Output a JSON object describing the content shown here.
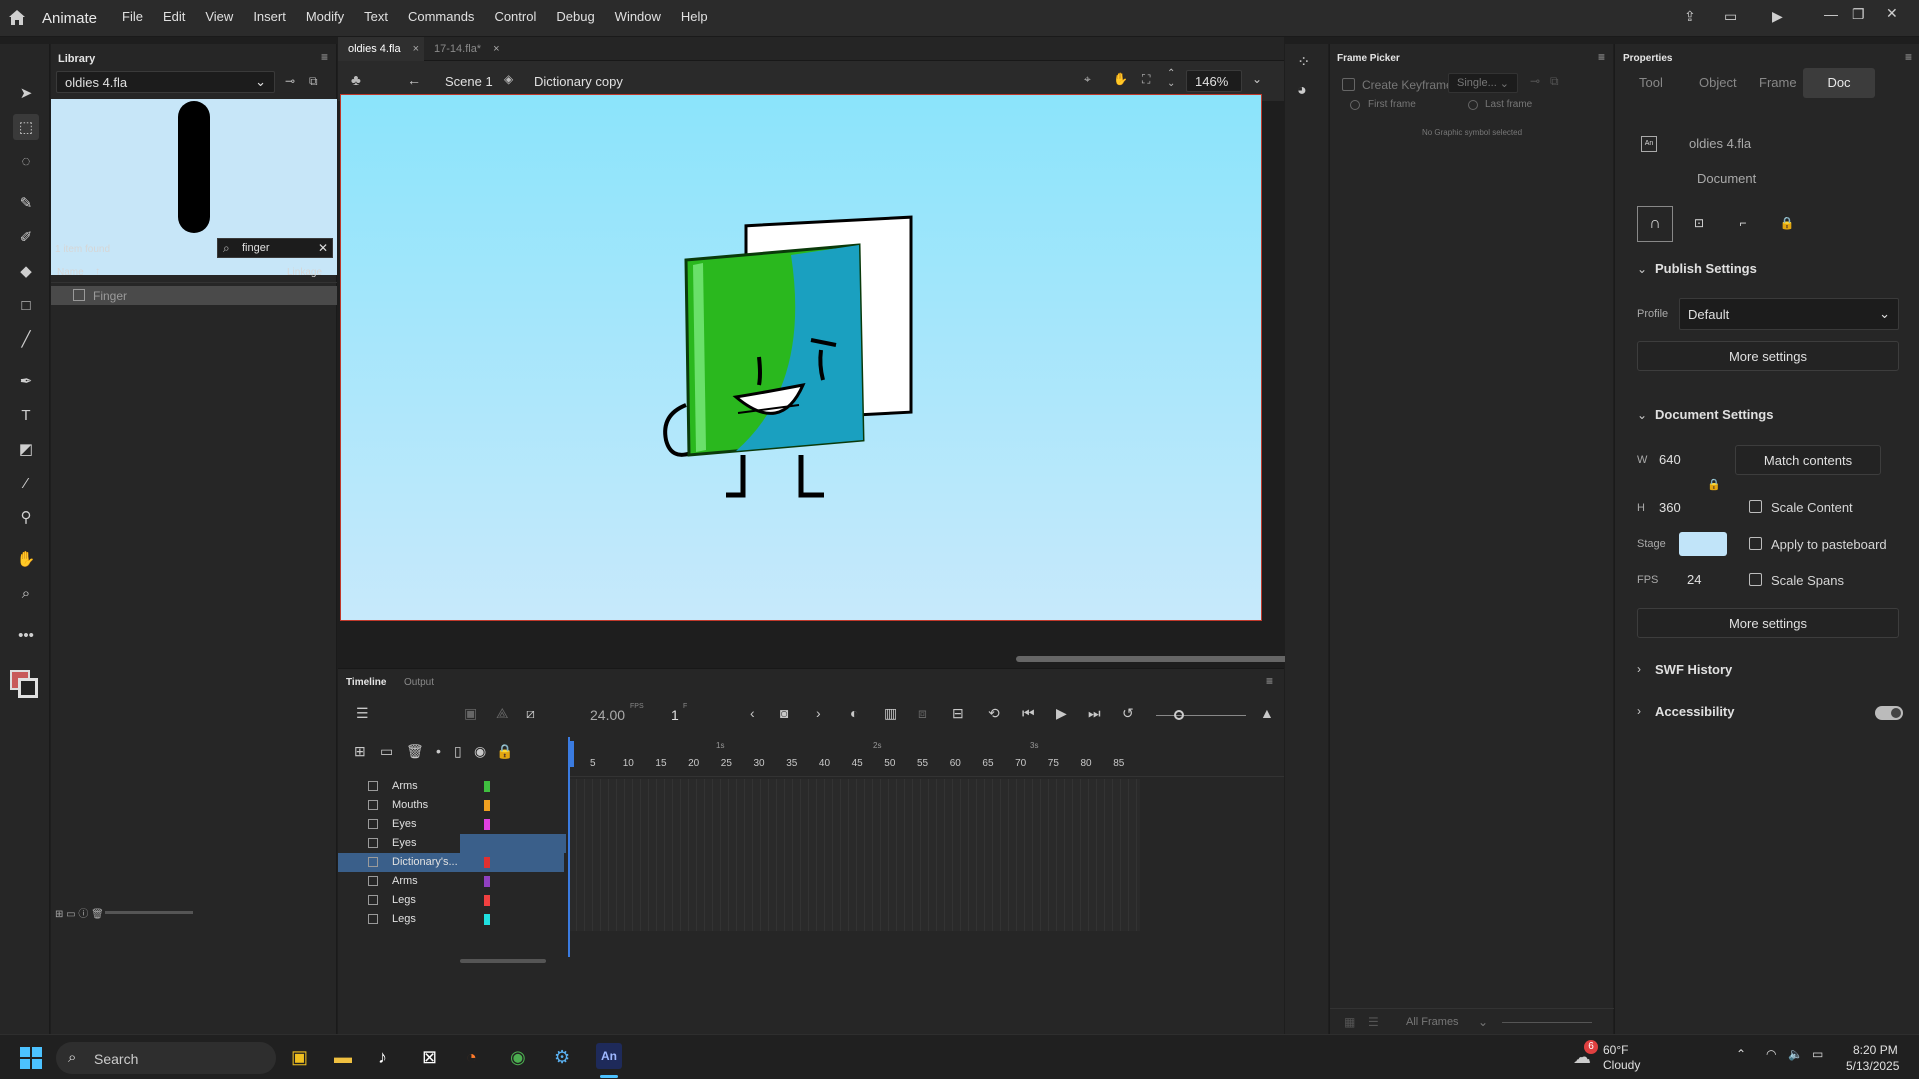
{
  "app": {
    "name": "Animate",
    "menus": [
      "File",
      "Edit",
      "View",
      "Insert",
      "Modify",
      "Text",
      "Commands",
      "Control",
      "Debug",
      "Window",
      "Help"
    ]
  },
  "library": {
    "title": "Library",
    "file": "oldies 4.fla",
    "found": "1 item found",
    "search": "finger",
    "col_name": "Name",
    "col_link": "Linkage",
    "item": "Finger"
  },
  "tabs": [
    {
      "label": "oldies 4.fla"
    },
    {
      "label": "17-14.fla*"
    }
  ],
  "editbar": {
    "scene": "Scene 1",
    "symbol": "Dictionary copy",
    "zoom": "146%"
  },
  "timeline": {
    "tab1": "Timeline",
    "tab2": "Output",
    "fps": "24.00",
    "fps_unit": "FPS",
    "frame": "1",
    "frame_unit": "F",
    "ruler": [
      "5",
      "10",
      "15",
      "20",
      "25",
      "30",
      "35",
      "40",
      "45",
      "50",
      "55",
      "60",
      "65",
      "70",
      "75",
      "80",
      "85"
    ],
    "seconds": [
      "1s",
      "2s",
      "3s"
    ],
    "layers": [
      {
        "name": "Arms",
        "color": "#3fbf3f"
      },
      {
        "name": "Mouths",
        "color": "#f0a020"
      },
      {
        "name": "Eyes",
        "color": "#e040e0"
      },
      {
        "name": "Eyes",
        "color": "#20b0a0"
      },
      {
        "name": "Dictionary's...",
        "color": "#e03030",
        "selected": true
      },
      {
        "name": "Arms",
        "color": "#9040c0"
      },
      {
        "name": "Legs",
        "color": "#f04040"
      },
      {
        "name": "Legs",
        "color": "#20e0e0"
      }
    ]
  },
  "framepicker": {
    "title": "Frame Picker",
    "create_kf": "Create Keyframe",
    "mode": "Single...",
    "first": "First frame",
    "last": "Last frame",
    "empty": "No Graphic symbol selected",
    "all_frames": "All Frames"
  },
  "props": {
    "title": "Properties",
    "tabs": [
      "Tool",
      "Object",
      "Frame",
      "Doc"
    ],
    "doc_name": "oldies 4.fla",
    "doc_label": "Document",
    "publish": "Publish Settings",
    "profile_label": "Profile",
    "profile": "Default",
    "more": "More settings",
    "docset": "Document Settings",
    "w_label": "W",
    "w": "640",
    "h_label": "H",
    "h": "360",
    "match": "Match contents",
    "scale_content": "Scale Content",
    "stage_label": "Stage",
    "apply_paste": "Apply to pasteboard",
    "fps_label": "FPS",
    "fps": "24",
    "scale_spans": "Scale Spans",
    "swf": "SWF History",
    "access": "Accessibility"
  },
  "taskbar": {
    "search": "Search",
    "temp": "60°F",
    "weather": "Cloudy",
    "badge": "6",
    "time": "8:20 PM",
    "date": "5/13/2025"
  }
}
